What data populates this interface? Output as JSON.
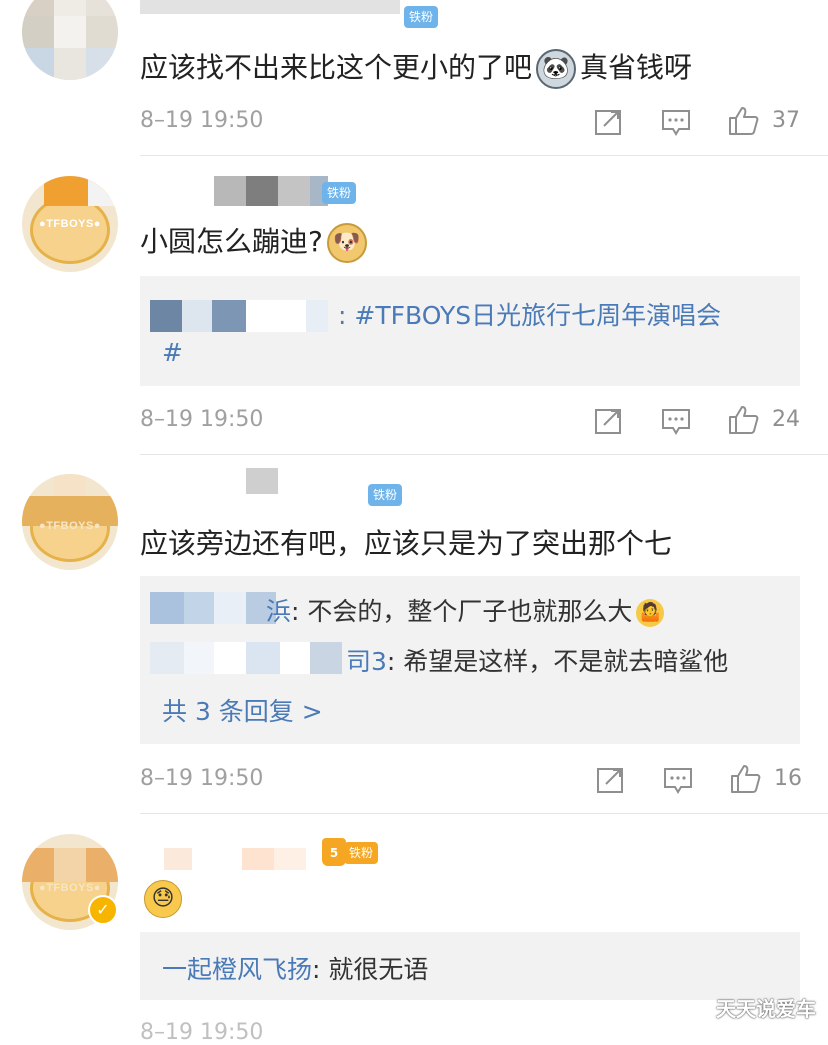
{
  "colors": {
    "link": "#4a7ab7",
    "meta": "#a0a0a0",
    "badge_blue": "#6eb3ea",
    "badge_gold": "#f5a623",
    "reply_bg": "#f2f2f2"
  },
  "comments": [
    {
      "badge": "铁粉",
      "text": "应该找不出来比这个更小的了吧",
      "emoji": "panda-face-emoji",
      "text_after": "真省钱呀",
      "time": "8–19 19:50",
      "likes": "37"
    },
    {
      "badge": "铁粉",
      "avatar_logo": "●TFBOYS●",
      "text": "小圆怎么蹦迪?",
      "emoji": "doge-emoji",
      "reply_prefix": ":",
      "reply_text": "#TFBOYS日光旅行七周年演唱会",
      "reply_text_cont": "#",
      "time": "8–19 19:50",
      "likes": "24"
    },
    {
      "badge": "铁粉",
      "avatar_logo": "●TFBOYS●",
      "text": "应该旁边还有吧，应该只是为了突出那个七",
      "replies": [
        {
          "name_tail": "浜",
          "text": ": 不会的，整个厂子也就那么大",
          "emoji": "shrug-emoji"
        },
        {
          "name_tail": "司3",
          "text": ": 希望是这样，不是就去暗鲨他"
        }
      ],
      "more": "共 3 条回复 >",
      "time": "8–19 19:50",
      "likes": "16"
    },
    {
      "badge": "铁粉",
      "badge_level": "5",
      "avatar_logo": "●TFBOYS●",
      "emoji": "sweat-face-emoji",
      "reply_name": "一起橙风飞扬",
      "reply_text": ": 就很无语",
      "time": "8–19 19:50"
    }
  ],
  "watermark": "天天说爱车"
}
